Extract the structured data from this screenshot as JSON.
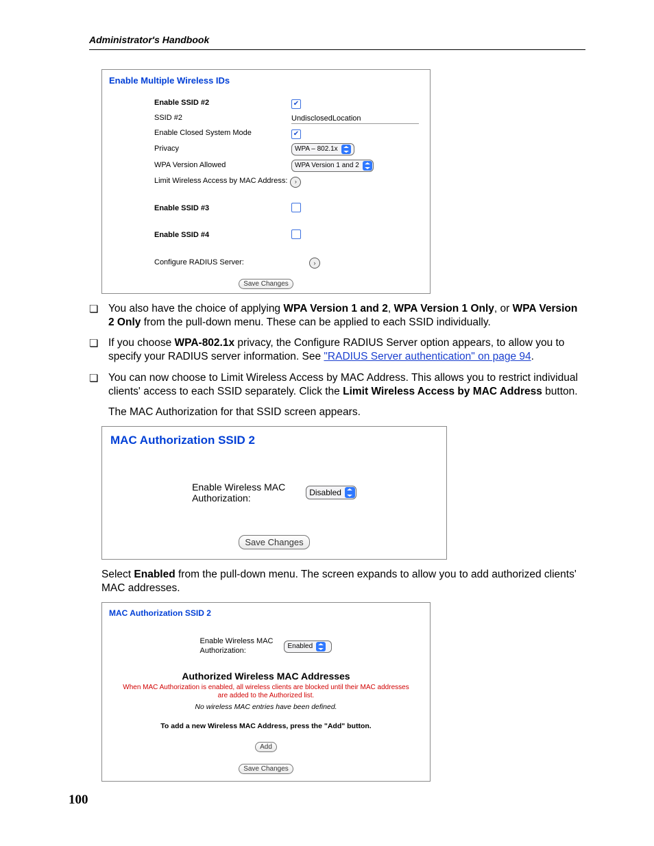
{
  "running_head": "Administrator's Handbook",
  "page_number": "100",
  "panel1": {
    "title": "Enable Multiple Wireless IDs",
    "rows": {
      "enable_ssid2": "Enable SSID #2",
      "ssid2": "SSID #2",
      "ssid2_value": "UndisclosedLocation",
      "closed_mode": "Enable Closed System Mode",
      "privacy": "Privacy",
      "privacy_value": "WPA – 802.1x",
      "wpa_version": "WPA Version Allowed",
      "wpa_version_value": "WPA Version 1 and 2",
      "limit_mac": "Limit Wireless Access by MAC Address:",
      "enable_ssid3": "Enable SSID #3",
      "enable_ssid4": "Enable SSID #4",
      "radius": "Configure RADIUS Server:",
      "save": "Save Changes"
    }
  },
  "bullets": {
    "b1_a": "You also have the choice of applying ",
    "b1_s1": "WPA Version 1 and 2",
    "b1_c1": ", ",
    "b1_s2": "WPA Version 1 Only",
    "b1_c2": ", or ",
    "b1_s3": "WPA Version 2 Only",
    "b1_b": " from the pull-down menu. These can be applied to each SSID individually.",
    "b2_a": "If you choose ",
    "b2_s1": "WPA-802.1x",
    "b2_b": " privacy, the Configure RADIUS Server option appears, to allow you to specify your RADIUS server information. See ",
    "b2_link": "\"RADIUS Server authentication\" on page 94",
    "b2_c": ".",
    "b3_a": "You can now choose to Limit Wireless Access by MAC Address. This allows you to restrict individual clients' access to each SSID separately. Click the ",
    "b3_s1": "Limit Wireless Access by MAC Address",
    "b3_b": " button.",
    "follow1": "The MAC Authorization for that SSID screen appears."
  },
  "panel2": {
    "title": "MAC Authorization SSID 2",
    "label_l1": "Enable Wireless MAC",
    "label_l2": "Authorization:",
    "value": "Disabled",
    "save": "Save Changes"
  },
  "mid": {
    "a": "Select ",
    "s1": "Enabled",
    "b": " from the pull-down menu. The screen expands to allow you to add authorized clients' MAC addresses."
  },
  "panel3": {
    "title": "MAC Authorization SSID 2",
    "label_l1": "Enable Wireless MAC",
    "label_l2": "Authorization:",
    "value": "Enabled",
    "section": "Authorized Wireless MAC Addresses",
    "warn": "When MAC Authorization is enabled, all wireless clients are blocked until their MAC addresses are added to the Authorized list.",
    "none": "No wireless MAC entries have been defined.",
    "add_note": "To add a new Wireless MAC Address, press the \"Add\" button.",
    "add": "Add",
    "save": "Save Changes"
  }
}
